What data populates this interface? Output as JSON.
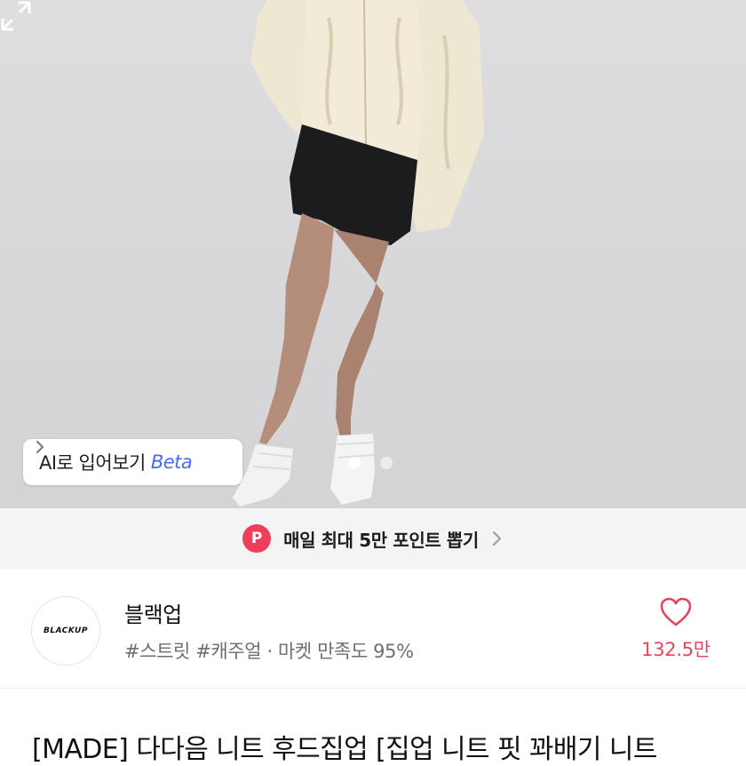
{
  "hero": {
    "image_description_icon": "product-photo",
    "ai_try_on": {
      "label": "AI로 입어보기",
      "badge": "Beta"
    },
    "pagination": {
      "current": 1,
      "total": 2
    }
  },
  "promo": {
    "badge": "P",
    "text": "매일 최대 5만 포인트 뽑기"
  },
  "store": {
    "logo_text": "BLACKUP",
    "name": "블랙업",
    "tags": "#스트릿 #캐주얼 · 마켓 만족도 95%",
    "likes": "132.5만"
  },
  "product": {
    "title": "[MADE] 다다음 니트 후드집업 [집업 니트 핏 꽈배기 니트"
  },
  "colors": {
    "accent_red": "#e4465e",
    "promo_badge": "#ef3e5a",
    "beta_blue": "#4a6cf2"
  }
}
